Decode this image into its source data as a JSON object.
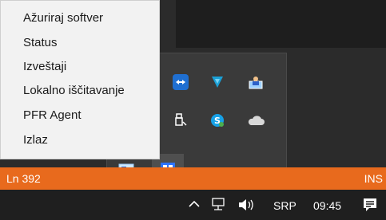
{
  "context_menu": {
    "items": [
      {
        "label": "Ažuriraj softver"
      },
      {
        "label": "Status"
      },
      {
        "label": "Izveštaji"
      },
      {
        "label": "Lokalno iščitavanje"
      },
      {
        "label": "PFR Agent"
      },
      {
        "label": "Izlaz"
      }
    ]
  },
  "status_bar": {
    "line_label": "Ln 392",
    "mode_label": "INS",
    "color": "#e86a1d"
  },
  "tray_overflow": {
    "icons": [
      {
        "name": "teamviewer-icon"
      },
      {
        "name": "shield-v-icon"
      },
      {
        "name": "user-monitor-icon"
      },
      {
        "name": "usb-safe-remove-icon"
      },
      {
        "name": "skype-icon"
      },
      {
        "name": "onedrive-cloud-icon"
      },
      {
        "name": "card-reader-icon"
      },
      {
        "name": "pfr-app-icon"
      }
    ]
  },
  "taskbar": {
    "language": "SRP",
    "time": "09:45"
  }
}
